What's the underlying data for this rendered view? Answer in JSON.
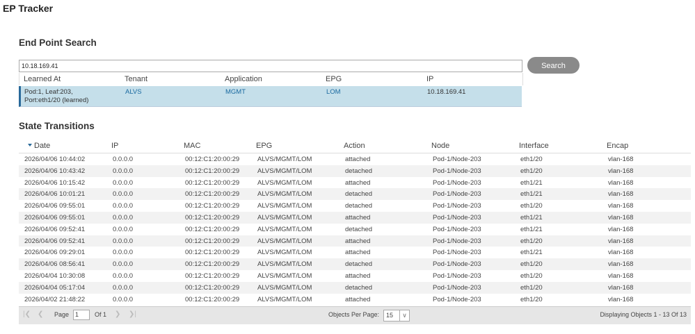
{
  "app": {
    "title": "EP Tracker"
  },
  "search": {
    "section_title": "End Point Search",
    "value": "10.18.169.41",
    "button_label": "Search",
    "columns": [
      "Learned At",
      "Tenant",
      "Application",
      "EPG",
      "IP"
    ],
    "result": {
      "learned_at_line1": "Pod:1, Leaf:203,",
      "learned_at_line2": "Port:eth1/20 (learned)",
      "tenant": "ALVS",
      "application": "MGMT",
      "epg": "LOM",
      "ip": "10.18.169.41"
    }
  },
  "transitions": {
    "section_title": "State Transitions",
    "columns": [
      "Date",
      "IP",
      "MAC",
      "EPG",
      "Action",
      "Node",
      "Interface",
      "Encap"
    ],
    "rows": [
      [
        "2026/04/06 10:44:02",
        "0.0.0.0",
        "00:12:C1:20:00:29",
        "ALVS/MGMT/LOM",
        "attached",
        "Pod-1/Node-203",
        "eth1/20",
        "vlan-168"
      ],
      [
        "2026/04/06 10:43:42",
        "0.0.0.0",
        "00:12:C1:20:00:29",
        "ALVS/MGMT/LOM",
        "detached",
        "Pod-1/Node-203",
        "eth1/20",
        "vlan-168"
      ],
      [
        "2026/04/06 10:15:42",
        "0.0.0.0",
        "00:12:C1:20:00:29",
        "ALVS/MGMT/LOM",
        "attached",
        "Pod-1/Node-203",
        "eth1/21",
        "vlan-168"
      ],
      [
        "2026/04/06 10:01:21",
        "0.0.0.0",
        "00:12:C1:20:00:29",
        "ALVS/MGMT/LOM",
        "detached",
        "Pod-1/Node-203",
        "eth1/21",
        "vlan-168"
      ],
      [
        "2026/04/06 09:55:01",
        "0.0.0.0",
        "00:12:C1:20:00:29",
        "ALVS/MGMT/LOM",
        "detached",
        "Pod-1/Node-203",
        "eth1/20",
        "vlan-168"
      ],
      [
        "2026/04/06 09:55:01",
        "0.0.0.0",
        "00:12:C1:20:00:29",
        "ALVS/MGMT/LOM",
        "attached",
        "Pod-1/Node-203",
        "eth1/21",
        "vlan-168"
      ],
      [
        "2026/04/06 09:52:41",
        "0.0.0.0",
        "00:12:C1:20:00:29",
        "ALVS/MGMT/LOM",
        "detached",
        "Pod-1/Node-203",
        "eth1/21",
        "vlan-168"
      ],
      [
        "2026/04/06 09:52:41",
        "0.0.0.0",
        "00:12:C1:20:00:29",
        "ALVS/MGMT/LOM",
        "attached",
        "Pod-1/Node-203",
        "eth1/20",
        "vlan-168"
      ],
      [
        "2026/04/06 09:29:01",
        "0.0.0.0",
        "00:12:C1:20:00:29",
        "ALVS/MGMT/LOM",
        "attached",
        "Pod-1/Node-203",
        "eth1/21",
        "vlan-168"
      ],
      [
        "2026/04/06 08:56:41",
        "0.0.0.0",
        "00:12:C1:20:00:29",
        "ALVS/MGMT/LOM",
        "detached",
        "Pod-1/Node-203",
        "eth1/20",
        "vlan-168"
      ],
      [
        "2026/04/04 10:30:08",
        "0.0.0.0",
        "00:12:C1:20:00:29",
        "ALVS/MGMT/LOM",
        "attached",
        "Pod-1/Node-203",
        "eth1/20",
        "vlan-168"
      ],
      [
        "2026/04/04 05:17:04",
        "0.0.0.0",
        "00:12:C1:20:00:29",
        "ALVS/MGMT/LOM",
        "detached",
        "Pod-1/Node-203",
        "eth1/20",
        "vlan-168"
      ],
      [
        "2026/04/02 21:48:22",
        "0.0.0.0",
        "00:12:C1:20:00:29",
        "ALVS/MGMT/LOM",
        "attached",
        "Pod-1/Node-203",
        "eth1/20",
        "vlan-168"
      ]
    ]
  },
  "pager": {
    "page_label": "Page",
    "page_value": "1",
    "of_label": "Of 1",
    "per_page_label": "Objects Per Page:",
    "per_page_value": "15",
    "displaying": "Displaying Objects 1 - 13 Of 13"
  }
}
